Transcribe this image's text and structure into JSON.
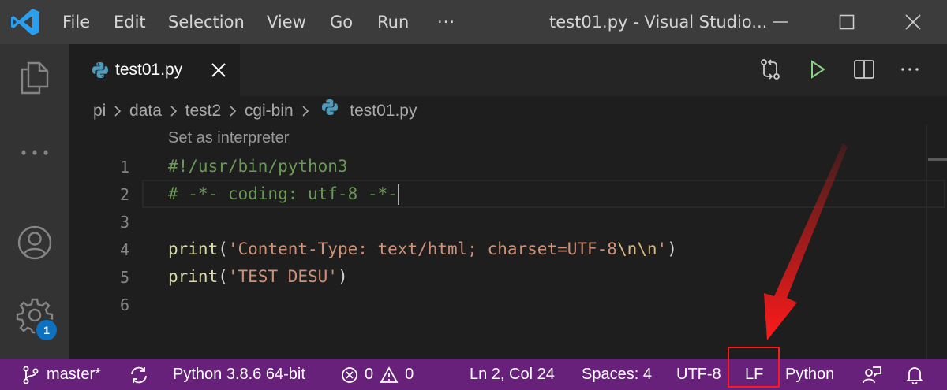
{
  "titlebar": {
    "menu": [
      "File",
      "Edit",
      "Selection",
      "View",
      "Go",
      "Run",
      "···"
    ],
    "window_title": "test01.py - Visual Studio...",
    "icons": [
      "vscode-logo",
      "minimize-icon",
      "maximize-icon",
      "close-icon"
    ]
  },
  "activitybar": {
    "icons": [
      "explorer-icon",
      "more-icon",
      "account-icon",
      "settings-gear-icon"
    ],
    "settings_badge": "1"
  },
  "tabs": [
    {
      "label": "test01.py",
      "active": true,
      "icon": "python-file-icon"
    }
  ],
  "editor_actions": [
    "open-changes-icon",
    "run-icon",
    "split-editor-icon",
    "more-actions-icon"
  ],
  "breadcrumb": [
    "pi",
    "data",
    "test2",
    "cgi-bin",
    "test01.py"
  ],
  "editor": {
    "codelens": "Set as interpreter",
    "lines": [
      {
        "no": "1",
        "text": "#!/usr/bin/python3"
      },
      {
        "no": "2",
        "text": "# -*- coding: utf-8 -*-"
      },
      {
        "no": "3",
        "text": ""
      },
      {
        "no": "4",
        "fn": "print",
        "open": "(",
        "str": "'Content-Type: text/html; charset=UTF-8",
        "esc": "\\n\\n",
        "str_end": "'",
        "close": ")"
      },
      {
        "no": "5",
        "fn": "print",
        "open": "(",
        "str": "'TEST DESU'",
        "close": ")"
      },
      {
        "no": "6",
        "text": ""
      }
    ]
  },
  "statusbar": {
    "branch": "master*",
    "interpreter": "Python 3.8.6 64-bit",
    "errors": "0",
    "warnings": "0",
    "position": "Ln 2, Col 24",
    "indent": "Spaces: 4",
    "encoding": "UTF-8",
    "eol": "LF",
    "language": "Python"
  },
  "colors": {
    "statusbar": "#68217a",
    "highlight": "#ff1a1a",
    "comment": "#6a9955",
    "string": "#ce9178",
    "function": "#dcdcaa"
  }
}
